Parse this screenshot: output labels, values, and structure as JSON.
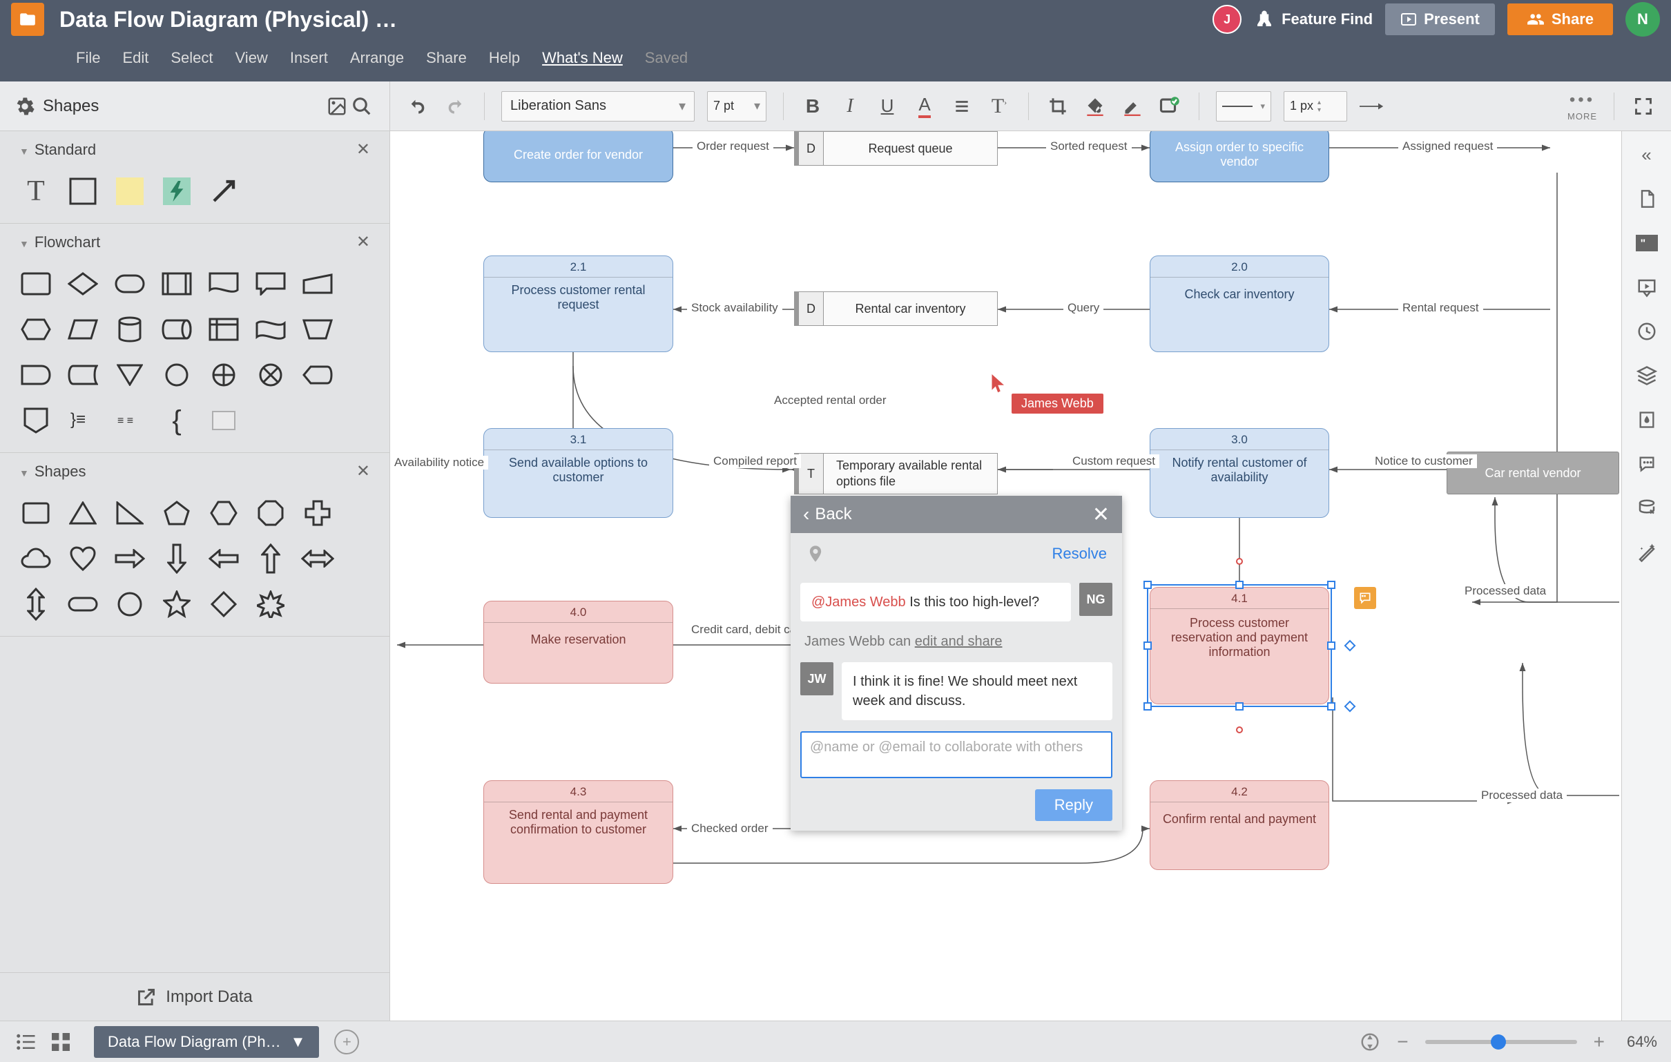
{
  "header": {
    "title": "Data Flow Diagram (Physical) …",
    "avatar1": "J",
    "avatar2": "N",
    "feature_find": "Feature Find",
    "present": "Present",
    "share": "Share"
  },
  "menu": {
    "file": "File",
    "edit": "Edit",
    "select": "Select",
    "view": "View",
    "insert": "Insert",
    "arrange": "Arrange",
    "share": "Share",
    "help": "Help",
    "whats_new": "What's New",
    "saved": "Saved"
  },
  "toolbar": {
    "shapes": "Shapes",
    "font": "Liberation Sans",
    "pt": "7 pt",
    "px": "1 px",
    "more": "MORE"
  },
  "sidebar": {
    "standard": "Standard",
    "flowchart": "Flowchart",
    "shapes": "Shapes",
    "import_data": "Import Data"
  },
  "footer": {
    "page_tab": "Data Flow Diagram (Ph…",
    "zoom": "64%"
  },
  "canvas": {
    "nodes": {
      "create_order": "Create order for vendor",
      "assign_order": "Assign order to specific vendor",
      "n21_id": "2.1",
      "n21": "Process customer rental request",
      "n20_id": "2.0",
      "n20": "Check car inventory",
      "n31_id": "3.1",
      "n31": "Send available options to customer",
      "n30_id": "3.0",
      "n30": "Notify rental customer of availability",
      "n40_id": "4.0",
      "n40": "Make reservation",
      "n41_id": "4.1",
      "n41": "Process customer reservation and payment information",
      "n43_id": "4.3",
      "n43": "Send rental and payment confirmation to customer",
      "n42_id": "4.2",
      "n42": "Confirm rental and payment",
      "vendor": "Car rental vendor",
      "ds_queue": "Request queue",
      "ds_inventory": "Rental car inventory",
      "ds_temp": "Temporary available rental options file",
      "ds_D": "D",
      "ds_T": "T"
    },
    "edges": {
      "order_request": "Order request",
      "sorted_request": "Sorted request",
      "assigned_request": "Assigned request",
      "stock_avail": "Stock availability",
      "query": "Query",
      "rental_request": "Rental request",
      "accepted": "Accepted rental order",
      "compiled": "Compiled report",
      "custom": "Custom request",
      "notice": "Notice to customer",
      "avail_notice": "Availability notice",
      "credit": "Credit card, debit card, or cash",
      "processed": "Processed data",
      "processed2": "Processed data",
      "checked": "Checked order"
    },
    "cursor_user": "James Webb"
  },
  "comment": {
    "back": "Back",
    "resolve": "Resolve",
    "c1_mention": "@James Webb",
    "c1_text": " Is this too high-level?",
    "c1_badge": "NG",
    "meta_user": "James Webb",
    "meta_can": " can ",
    "meta_action": "edit and share",
    "c2_badge": "JW",
    "c2_text": "I think it is fine! We should meet next week and discuss.",
    "placeholder": "@name or @email to collaborate with others",
    "reply": "Reply"
  }
}
